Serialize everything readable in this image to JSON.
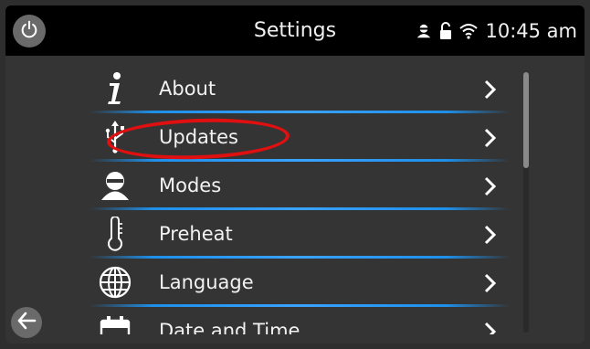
{
  "window": {
    "title": "Settings"
  },
  "status_bar": {
    "time": "10:45 am",
    "icons": [
      "user-icon",
      "lock-open-icon",
      "wifi-icon"
    ]
  },
  "header": {
    "power_icon": "power-icon"
  },
  "menu": {
    "items": [
      {
        "label": "About",
        "icon": "info-icon"
      },
      {
        "label": "Updates",
        "icon": "usb-icon"
      },
      {
        "label": "Modes",
        "icon": "user-profile-icon"
      },
      {
        "label": "Preheat",
        "icon": "thermometer-icon"
      },
      {
        "label": "Language",
        "icon": "globe-icon"
      },
      {
        "label": "Date and Time",
        "icon": "calendar-icon"
      }
    ]
  },
  "footer": {
    "back_icon": "arrow-left-icon"
  },
  "colors": {
    "topbar": "#000000",
    "background": "#343434",
    "separator": "#1e8fe8",
    "highlight_ring": "#e01010",
    "button_gray": "#6a6a6a"
  }
}
